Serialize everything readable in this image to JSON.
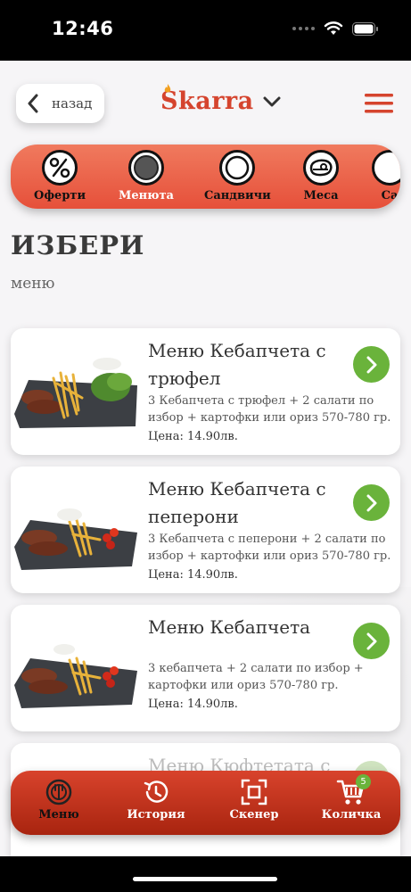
{
  "status": {
    "time": "12:46"
  },
  "header": {
    "back_label": "назад",
    "logo_text": "Skarra"
  },
  "categories": [
    {
      "label": "Оферти",
      "icon": "percent-icon"
    },
    {
      "label": "Менюта",
      "icon": "menu-plate-icon"
    },
    {
      "label": "Сандвичи",
      "icon": "sandwich-icon"
    },
    {
      "label": "Меса",
      "icon": "meat-icon"
    },
    {
      "label": "Са",
      "icon": "salad-icon"
    }
  ],
  "page": {
    "title": "ИЗБЕРИ",
    "subtitle": "меню"
  },
  "items": [
    {
      "title": "Меню Кебапчета с трюфел",
      "description": "3 Кебапчета с трюфел + 2 салати по избор + картофки или ориз 570-780 гр.",
      "price": "Цена: 14.90лв."
    },
    {
      "title": "Меню Кебапчета с пеперони",
      "description": "3 Кебапчета с пеперони + 2 салати по избор + картофки или ориз 570-780 гр.",
      "price": "Цена: 14.90лв."
    },
    {
      "title": "Меню Кебапчета",
      "description": "3 кебапчета + 2 салати по избор + картофки или ориз 570-780 гр.",
      "price": "Цена: 14.90лв."
    },
    {
      "title": "Меню Кюфтетата с",
      "description": "",
      "price": ""
    }
  ],
  "bottom_nav": [
    {
      "label": "Меню",
      "icon": "menu-icon"
    },
    {
      "label": "История",
      "icon": "history-icon"
    },
    {
      "label": "Скенер",
      "icon": "scanner-icon"
    },
    {
      "label": "Количка",
      "icon": "cart-icon"
    }
  ],
  "cart_count": "5",
  "colors": {
    "accent_red": "#e6503a",
    "go_green": "#6ab33b",
    "background": "#f6f5f7"
  }
}
